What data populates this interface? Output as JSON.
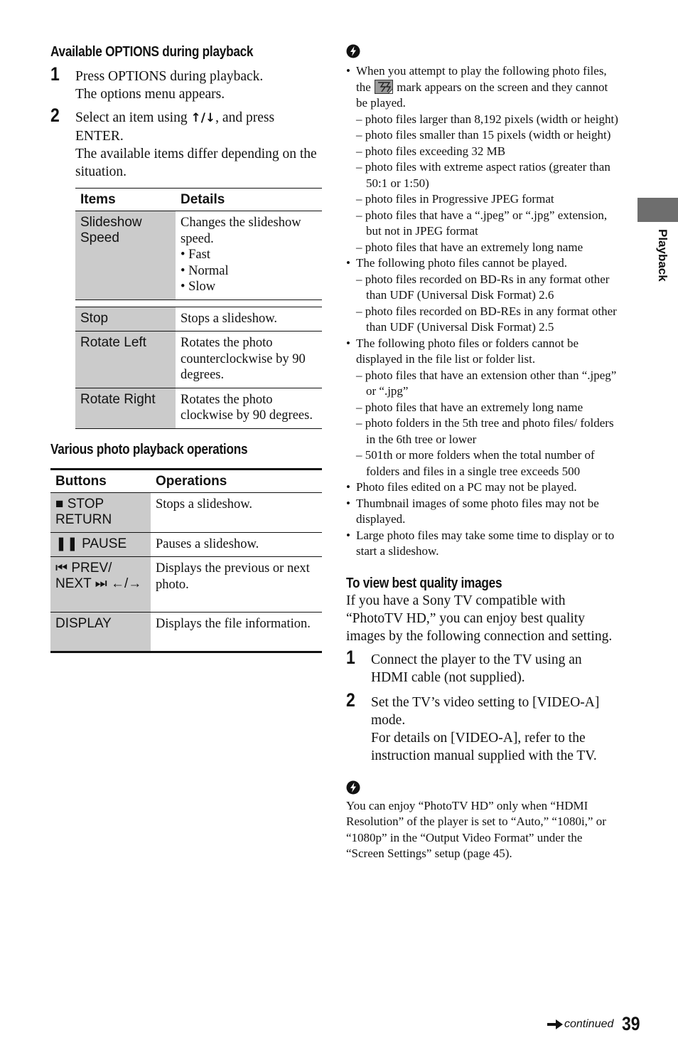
{
  "left": {
    "options_heading": "Available OPTIONS during playback",
    "steps": [
      {
        "num": "1",
        "lines": [
          "Press OPTIONS during playback.",
          "The options menu appears."
        ]
      },
      {
        "num": "2",
        "line1_prefix": "Select an item using ",
        "line1_keys": "↑/↓",
        "line1_suffix": ", and press ENTER.",
        "line2": "The available items differ depending on the situation."
      }
    ],
    "items_table": {
      "headers": [
        "Items",
        "Details"
      ],
      "rows": [
        {
          "item": "Slideshow Speed",
          "details": "Changes the slideshow speed.",
          "options": [
            "Fast",
            "Normal",
            "Slow"
          ]
        },
        {
          "item": "Stop",
          "details": "Stops a slideshow."
        },
        {
          "item": "Rotate Left",
          "details": "Rotates the photo counterclockwise by 90 degrees."
        },
        {
          "item": "Rotate Right",
          "details": "Rotates the photo clockwise by 90 degrees."
        }
      ]
    },
    "ops_heading": "Various photo playback operations",
    "ops_table": {
      "headers": [
        "Buttons",
        "Operations"
      ],
      "rows": [
        {
          "button": "■ STOP RETURN",
          "operation": "Stops a slideshow."
        },
        {
          "button": "❚❚ PAUSE",
          "operation": "Pauses a slideshow."
        },
        {
          "button": "⏮ PREV/ NEXT ⏭ ←/→",
          "operation": "Displays the previous or next photo."
        },
        {
          "button": "DISPLAY",
          "operation": "Displays the file information."
        }
      ]
    }
  },
  "right": {
    "hint_icon": "hint-icon",
    "bullets": [
      {
        "pre": "When you attempt to play the following photo files, the ",
        "icon": "unplayable-mark-icon",
        "post": " mark appears on the screen and they cannot be played.",
        "subs": [
          "photo files larger than 8,192 pixels (width or height)",
          "photo files smaller than 15 pixels (width or height)",
          "photo files exceeding 32 MB",
          "photo files with extreme aspect ratios (greater than 50:1 or 1:50)",
          "photo files in Progressive JPEG format",
          "photo files that have a “.jpeg” or “.jpg” extension, but not in JPEG format",
          "photo files that have an extremely long name"
        ]
      },
      {
        "text": "The following photo files cannot be played.",
        "subs": [
          "photo files recorded on BD-Rs in any format other than UDF (Universal Disk Format) 2.6",
          "photo files recorded on BD-REs in any format other than UDF (Universal Disk Format) 2.5"
        ]
      },
      {
        "text": "The following photo files or folders cannot be displayed in the file list or folder list.",
        "subs": [
          "photo files that have an extension other than “.jpeg” or “.jpg”",
          "photo files that have an extremely long name",
          "photo folders in the 5th tree and photo files/ folders in the 6th tree or lower",
          "501th or more folders when the total number of folders and files in a single tree exceeds 500"
        ]
      },
      {
        "text": "Photo files edited on a PC may not be played."
      },
      {
        "text": "Thumbnail images of some photo files may not be displayed."
      },
      {
        "text": "Large photo files may take some time to display or to start a slideshow."
      }
    ],
    "best_heading": "To view best quality images",
    "best_intro": "If you have a Sony TV compatible with “PhotoTV HD,” you can enjoy best quality images by the following connection and setting.",
    "best_steps": [
      {
        "num": "1",
        "lines": [
          "Connect the player to the TV using an HDMI cable (not supplied)."
        ]
      },
      {
        "num": "2",
        "lines": [
          "Set the TV’s video setting to [VIDEO-A] mode.",
          "For details on [VIDEO-A], refer to the instruction manual supplied with the TV."
        ]
      }
    ],
    "note": "You can enjoy “PhotoTV HD” only when “HDMI Resolution” of the player is set to “Auto,” “1080i,” or “1080p” in the “Output Video Format” under the “Screen Settings” setup (page 45)."
  },
  "side_tab": {
    "label": "Playback",
    "color": "#6e6e6e"
  },
  "footer": {
    "continued": "continued",
    "page": "39"
  }
}
